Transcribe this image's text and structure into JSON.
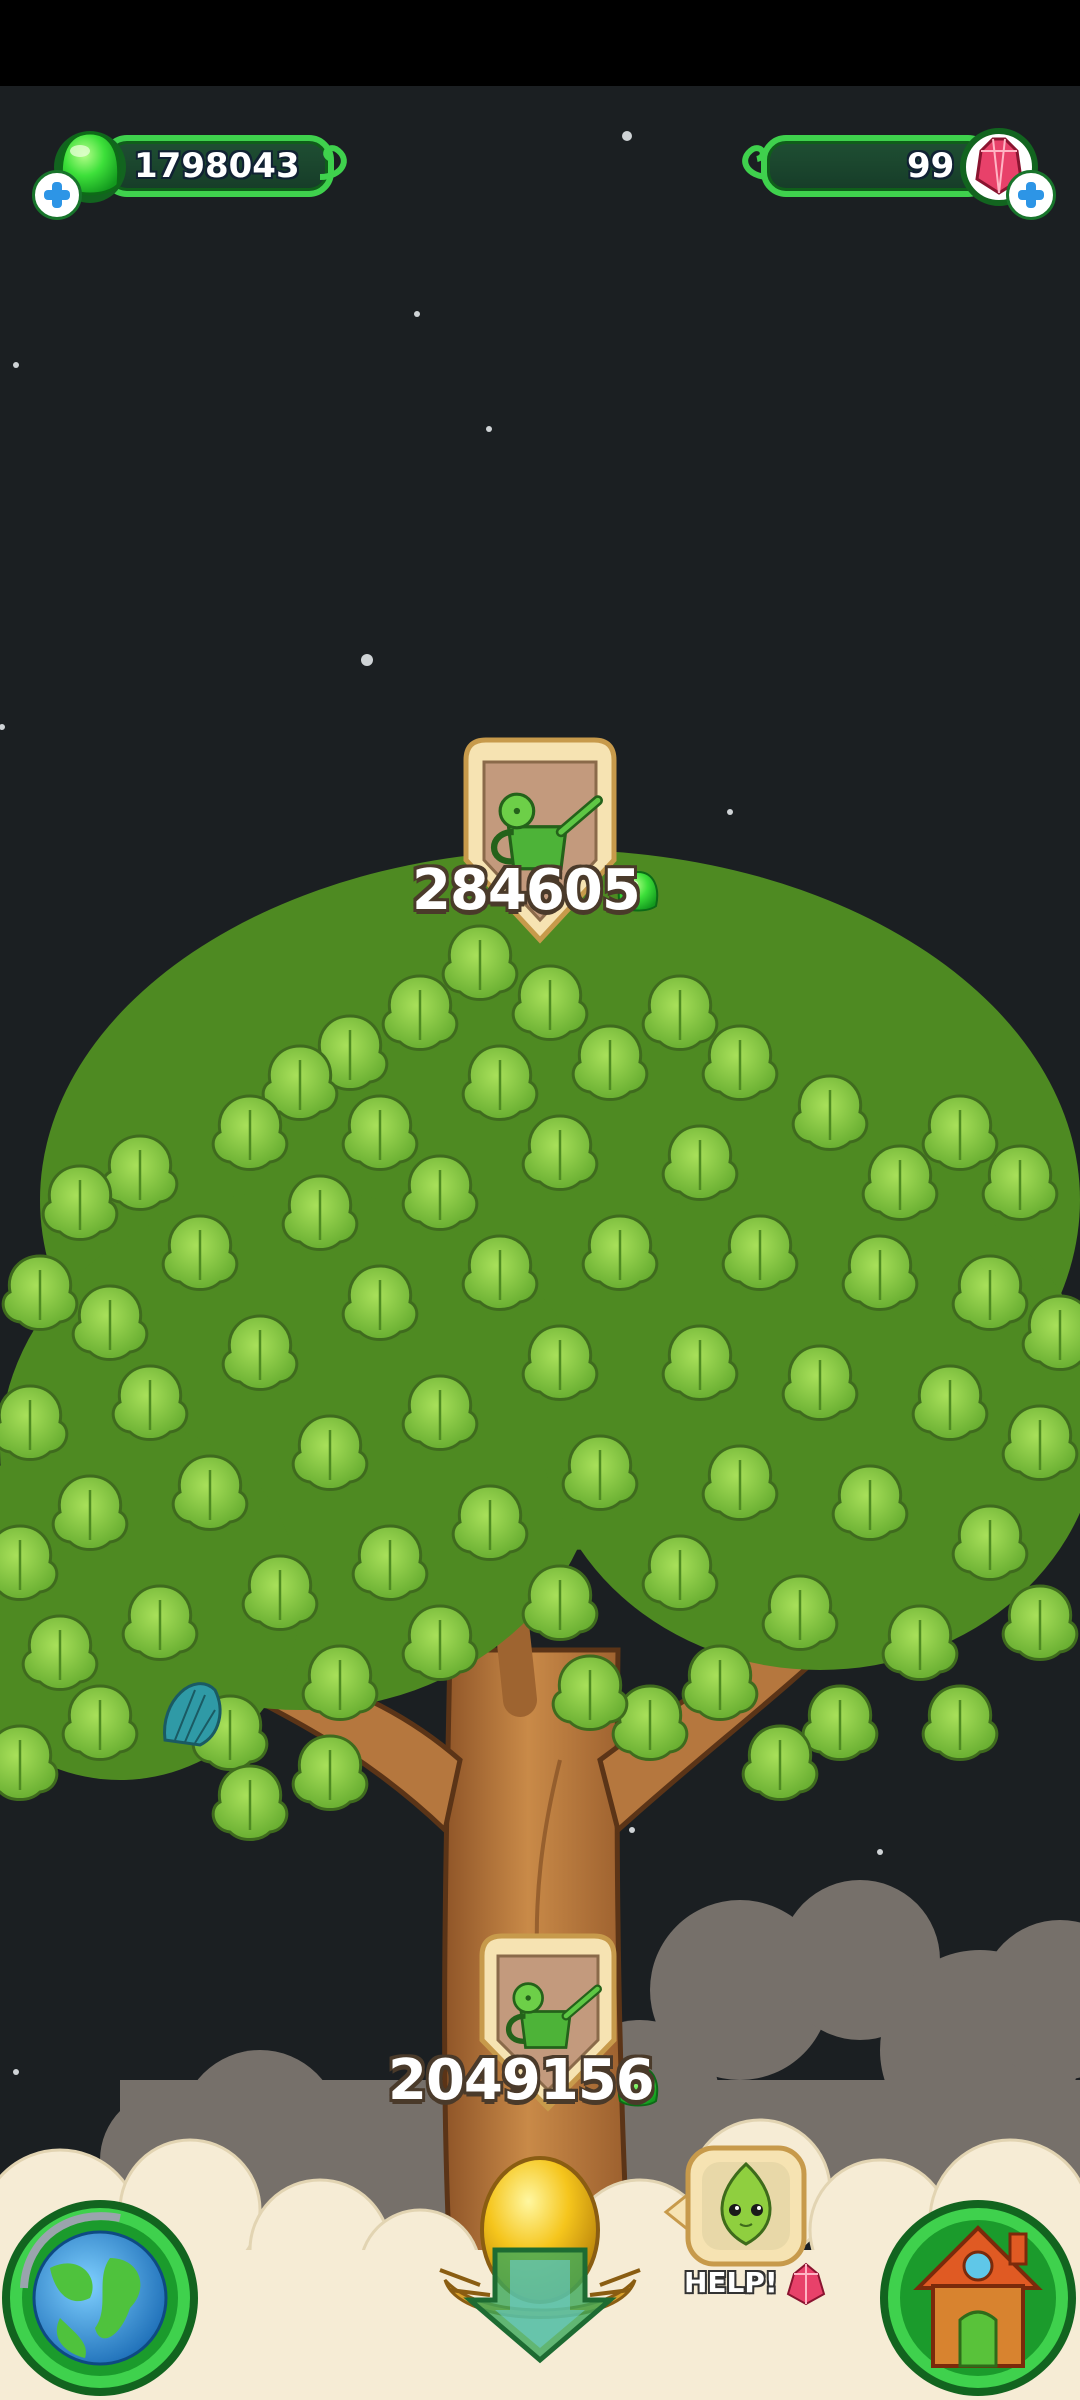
{
  "hud": {
    "gum_count": "1798043",
    "gem_count": "99",
    "gum_icon": "green-gumdrop-icon",
    "gem_icon": "red-crystal-icon",
    "add_icon": "blue-plus-icon"
  },
  "upgrades": {
    "top_cost": "284605",
    "bottom_cost": "2049156",
    "icon": "watering-can-icon",
    "currency_icon": "green-gumdrop-icon"
  },
  "bottom_bar": {
    "help_label": "HELP!",
    "left_icon": "globe-icon",
    "center_icon": "golden-egg-nest-icon",
    "right_icon": "house-icon",
    "help_icon": "leaf-creature-icon"
  },
  "colors": {
    "sky": "#1b1f22",
    "leaf": "#7ec83e",
    "trunk": "#b9783b",
    "hud_green": "#3fd14d"
  }
}
